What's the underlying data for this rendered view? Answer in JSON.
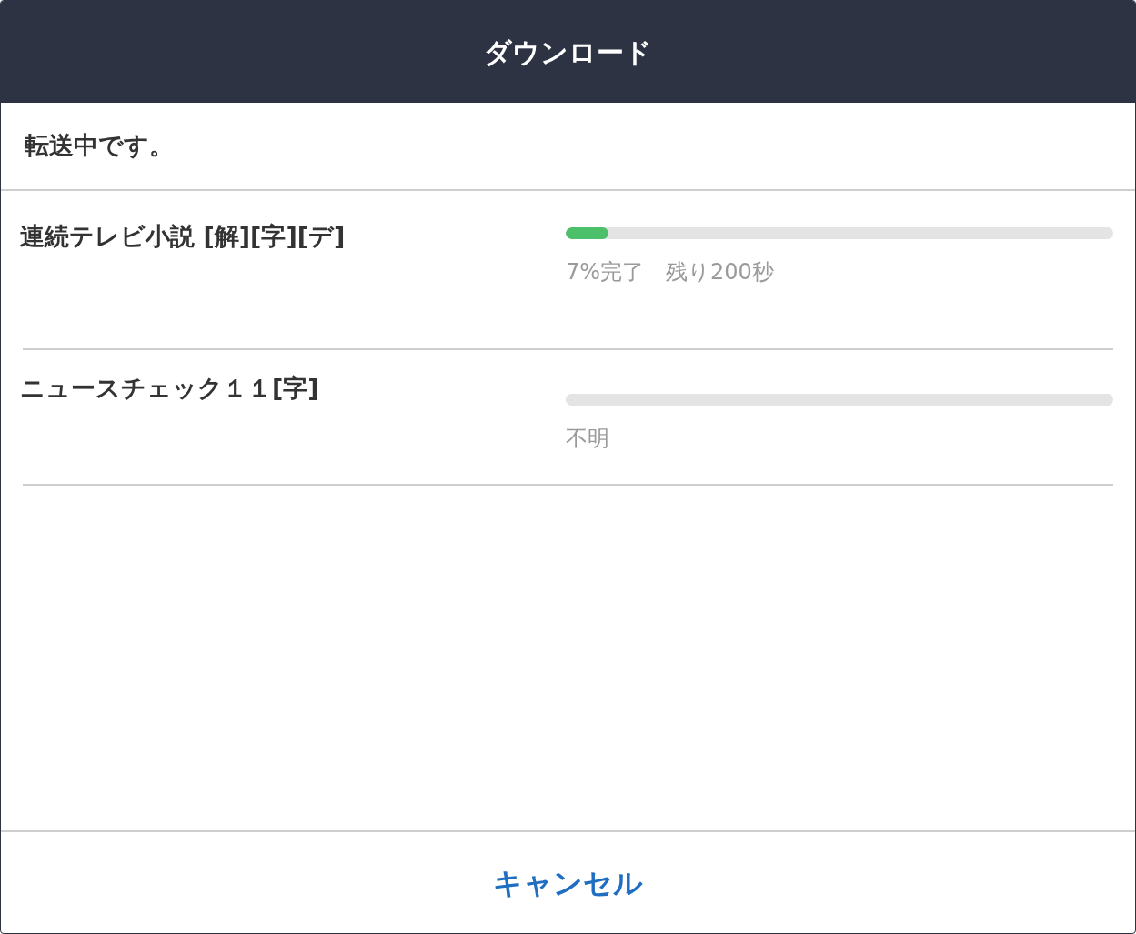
{
  "dialog": {
    "title": "ダウンロード"
  },
  "status": "転送中です。",
  "downloads": [
    {
      "name": "連続テレビ小説 [解][字][デ]",
      "level": 0.078,
      "progress_text": "7%完了　残り200秒"
    },
    {
      "name": "ニュースチェック１１[字]",
      "level": 0,
      "progress_text": "不明"
    }
  ],
  "cancel_button": "キャンセル"
}
